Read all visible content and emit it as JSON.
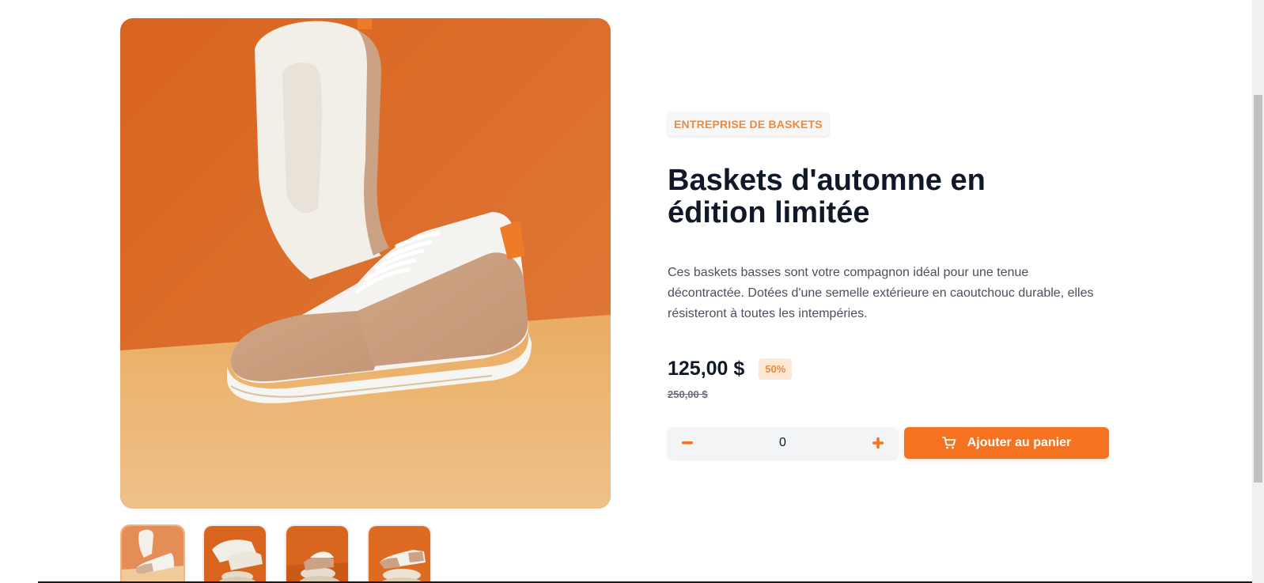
{
  "product": {
    "company": "ENTREPRISE DE BASKETS",
    "title": "Baskets d'automne en édition limitée",
    "description": "Ces baskets basses sont votre compagnon idéal pour une tenue décontractée. Dotées d'une semelle extérieure en caoutchouc durable, elles résisteront à toutes les intempéries.",
    "price": "125,00 $",
    "discount": "50%",
    "original_price": "250,00 $"
  },
  "cart": {
    "quantity": "0",
    "add_label": "Ajouter au panier"
  },
  "gallery": {
    "thumbnails_count": 4,
    "active_index": 0
  },
  "colors": {
    "accent": "#f57320",
    "accent_pale": "#fde9d6",
    "title": "#111827",
    "photo_orange": "#e06a24",
    "photo_tan": "#e8b77a"
  },
  "icons": [
    "minus-icon",
    "plus-icon",
    "cart-icon"
  ]
}
